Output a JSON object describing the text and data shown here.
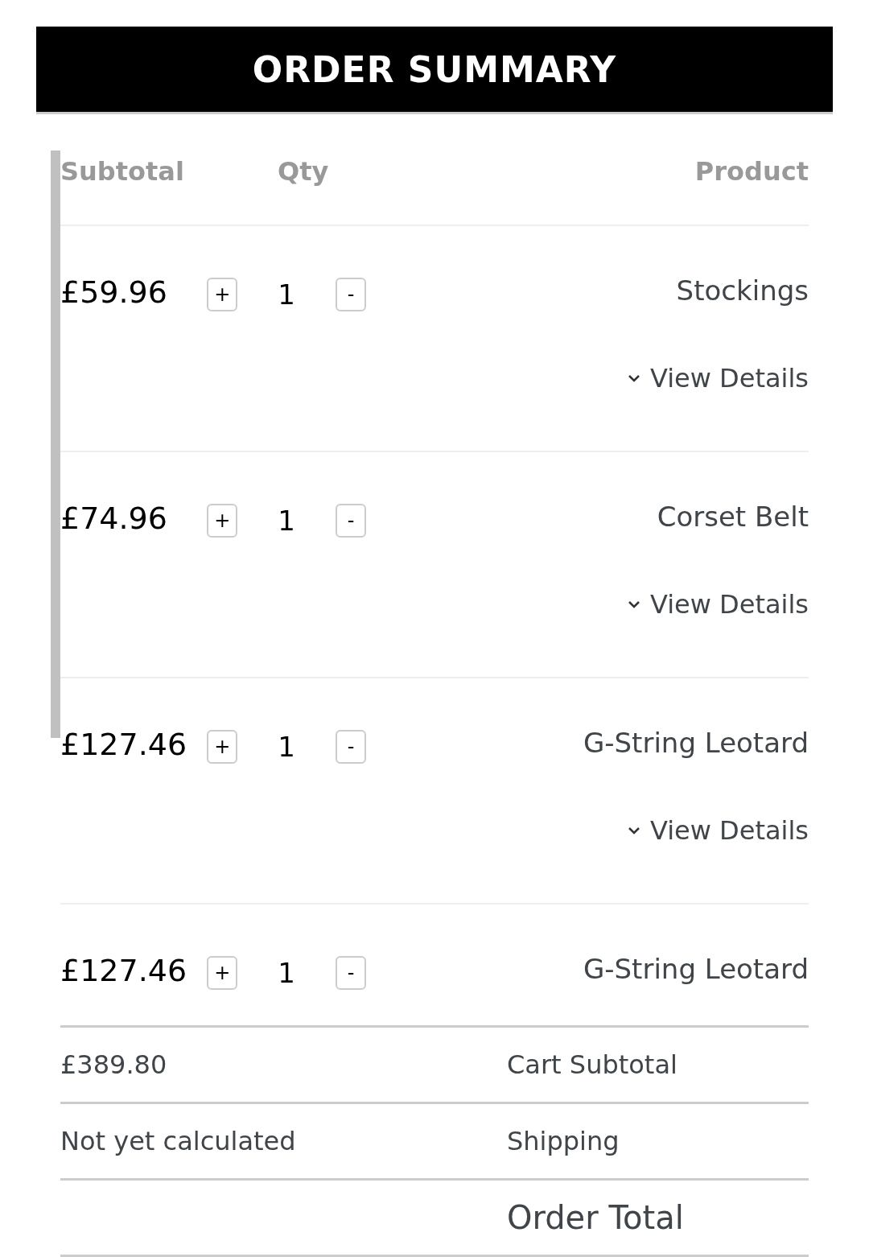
{
  "header": {
    "title": "ORDER SUMMARY"
  },
  "columns": [
    "Subtotal",
    "Qty",
    "Product"
  ],
  "items": [
    {
      "name": "Stockings",
      "qty": "1",
      "minus": "-",
      "plus": "+",
      "subtotal": "£59.96",
      "details": "View Details"
    },
    {
      "name": "Corset Belt",
      "qty": "1",
      "minus": "-",
      "plus": "+",
      "subtotal": "£74.96",
      "details": "View Details"
    },
    {
      "name": "G-String Leotard",
      "qty": "1",
      "minus": "-",
      "plus": "+",
      "subtotal": "£127.46",
      "details": "View Details"
    },
    {
      "name": "G-String Leotard",
      "qty": "1",
      "minus": "-",
      "plus": "+",
      "subtotal": "£127.46"
    }
  ],
  "totals": [
    {
      "label": "Cart Subtotal",
      "value": "£389.80"
    },
    {
      "label": "Shipping",
      "value": "Not yet calculated"
    },
    {
      "label": "Order Total"
    }
  ]
}
